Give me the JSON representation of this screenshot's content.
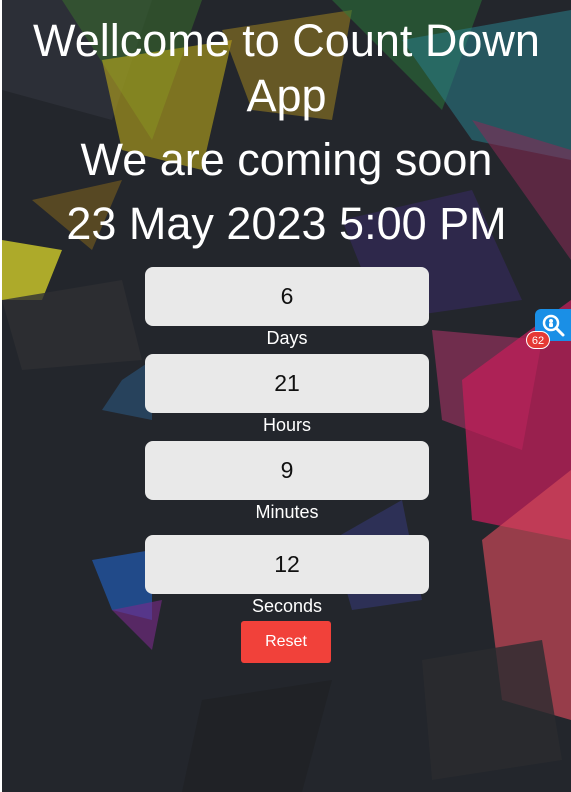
{
  "header": {
    "title": "Wellcome to Count Down App",
    "subtitle": "We are coming soon",
    "target_date": "23 May 2023 5:00 PM"
  },
  "countdown": {
    "days": {
      "value": "6",
      "label": "Days"
    },
    "hours": {
      "value": "21",
      "label": "Hours"
    },
    "minutes": {
      "value": "9",
      "label": "Minutes"
    },
    "seconds": {
      "value": "12",
      "label": "Seconds"
    }
  },
  "controls": {
    "reset_label": "Reset"
  },
  "extension": {
    "icon": "search-icon",
    "badge_count": "62"
  },
  "colors": {
    "background": "#23262c",
    "box": "#e9e9e9",
    "reset_button": "#f1413a",
    "extension": "#1a8fe6",
    "badge": "#e53935"
  }
}
